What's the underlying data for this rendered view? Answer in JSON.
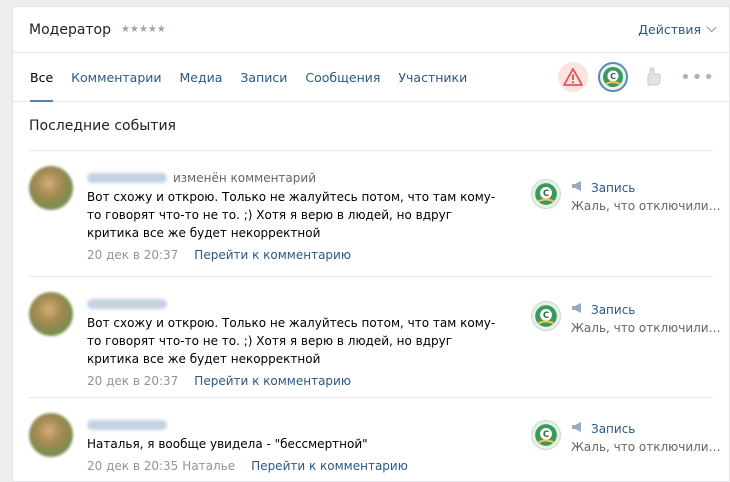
{
  "header": {
    "title": "Модератор",
    "rating": "★★★★★",
    "actions_label": "Действия"
  },
  "tabs": [
    {
      "label": "Все",
      "active": true
    },
    {
      "label": "Комментарии"
    },
    {
      "label": "Медиа"
    },
    {
      "label": "Записи"
    },
    {
      "label": "Сообщения"
    },
    {
      "label": "Участники"
    }
  ],
  "more_label": "•••",
  "section": {
    "title": "Последние события"
  },
  "events": [
    {
      "action": "изменён комментарий",
      "text": "Вот схожу и открою. Только не жалуйтесь потом, что там кому-то говорят что-то не то. ;) Хотя я верю в людей, но вдруг критика все же будет некорректной",
      "date": "20 дек в 20:37",
      "to": "",
      "link": "Перейти к комментарию",
      "target_type": "Запись",
      "target_snippet": "Жаль, что отключили к..."
    },
    {
      "action": "",
      "text": "Вот схожу и открою. Только не жалуйтесь потом, что там кому-то говорят что-то не то. ;) Хотя я верю в людей, но вдруг критика все же будет некорректной",
      "date": "20 дек в 20:37",
      "to": "",
      "link": "Перейти к комментарию",
      "target_type": "Запись",
      "target_snippet": "Жаль, что отключили к..."
    },
    {
      "action": "",
      "text": "Наталья, я вообще увидела - \"бессмертной\"",
      "date": "20 дек в 20:35",
      "to": "Наталье",
      "link": "Перейти к комментарию",
      "target_type": "Запись",
      "target_snippet": "Жаль, что отключили к..."
    }
  ],
  "colors": {
    "link": "#2a5885",
    "accent": "#5181b8",
    "muted": "#939393"
  }
}
